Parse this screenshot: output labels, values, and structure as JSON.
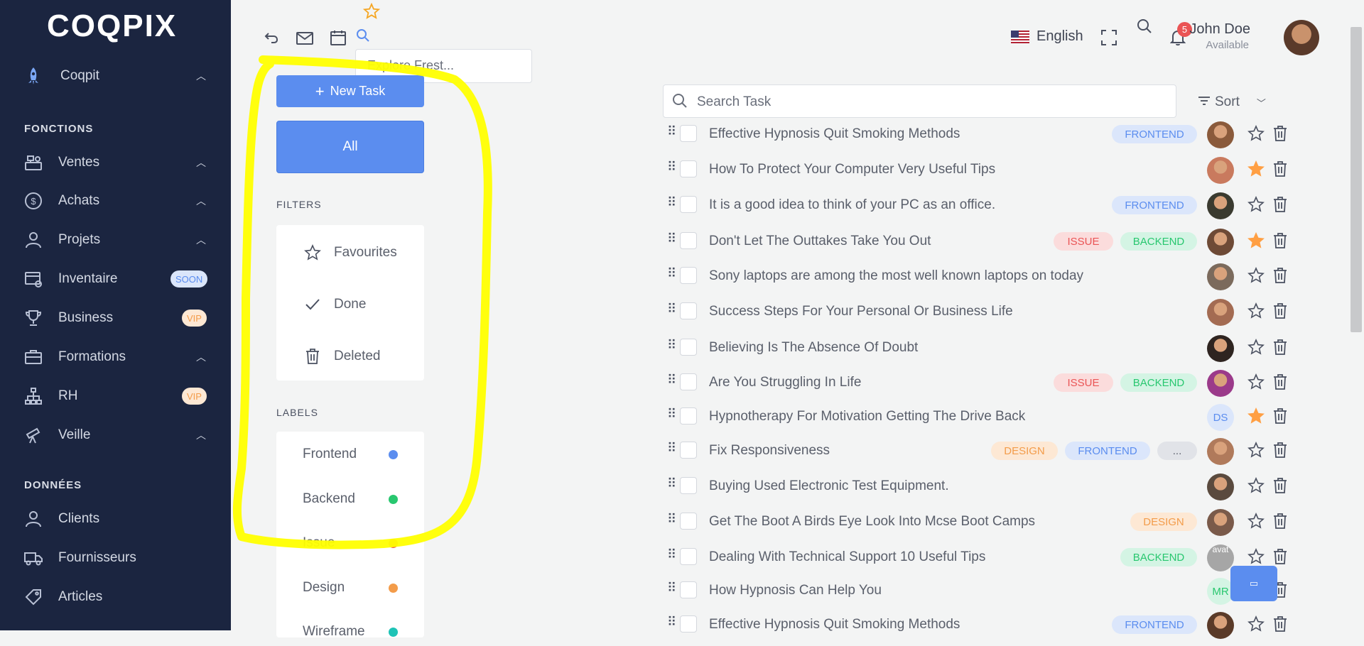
{
  "sidebar": {
    "logo": "COQPIX",
    "top_item": "Coqpit",
    "sections": [
      {
        "title": "FONCTIONS"
      },
      {
        "title": "DONNÉES"
      }
    ],
    "items": [
      {
        "label": "Ventes",
        "icon": "cash-register-icon"
      },
      {
        "label": "Achats",
        "icon": "dollar-circle-icon"
      },
      {
        "label": "Projets",
        "icon": "user-icon"
      },
      {
        "label": "Inventaire",
        "icon": "inventory-icon",
        "badge": "SOON"
      },
      {
        "label": "Business",
        "icon": "trophy-icon",
        "badge": "VIP"
      },
      {
        "label": "Formations",
        "icon": "briefcase-icon"
      },
      {
        "label": "RH",
        "icon": "org-chart-icon",
        "badge": "VIP"
      },
      {
        "label": "Veille",
        "icon": "telescope-icon"
      },
      {
        "label": "Clients",
        "icon": "user-icon"
      },
      {
        "label": "Fournisseurs",
        "icon": "truck-icon"
      },
      {
        "label": "Articles",
        "icon": "tag-icon"
      }
    ]
  },
  "topbar": {
    "explore_placeholder": "Explore Frest...",
    "language": "English",
    "notification_count": "5",
    "user_name": "John Doe",
    "user_status": "Available"
  },
  "panel": {
    "new_task": "New Task",
    "all": "All",
    "filters_title": "FILTERS",
    "filters": [
      "Favourites",
      "Done",
      "Deleted"
    ],
    "labels_title": "LABELS",
    "labels": [
      {
        "name": "Frontend",
        "color": "#5b8def"
      },
      {
        "name": "Backend",
        "color": "#28c76f"
      },
      {
        "name": "Issue",
        "color": "#ea5455"
      },
      {
        "name": "Design",
        "color": "#f39c4a"
      },
      {
        "name": "Wireframe",
        "color": "#1ec3b6"
      }
    ]
  },
  "main": {
    "search_placeholder": "Search Task",
    "sort_label": "Sort",
    "tasks": [
      {
        "title": "Effective Hypnosis Quit Smoking Methods",
        "tags": [
          "FRONTEND"
        ],
        "starred": false
      },
      {
        "title": "How To Protect Your Computer Very Useful Tips",
        "tags": [],
        "starred": true
      },
      {
        "title": "It is a good idea to think of your PC as an office.",
        "tags": [
          "FRONTEND"
        ],
        "starred": false
      },
      {
        "title": "Don't Let The Outtakes Take You Out",
        "tags": [
          "ISSUE",
          "BACKEND"
        ],
        "starred": true
      },
      {
        "title": "Sony laptops are among the most well known laptops on today",
        "tags": [],
        "starred": false
      },
      {
        "title": "Success Steps For Your Personal Or Business Life",
        "tags": [],
        "starred": false
      },
      {
        "title": "Believing Is The Absence Of Doubt",
        "tags": [],
        "starred": false
      },
      {
        "title": "Are You Struggling In Life",
        "tags": [
          "ISSUE",
          "BACKEND"
        ],
        "starred": false
      },
      {
        "title": "Hypnotherapy For Motivation Getting The Drive Back",
        "tags": [],
        "starred": true,
        "initials": "DS"
      },
      {
        "title": "Fix Responsiveness",
        "tags": [
          "DESIGN",
          "FRONTEND",
          "..."
        ],
        "starred": false
      },
      {
        "title": "Buying Used Electronic Test Equipment.",
        "tags": [],
        "starred": false
      },
      {
        "title": "Get The Boot A Birds Eye Look Into Mcse Boot Camps",
        "tags": [
          "DESIGN"
        ],
        "starred": false
      },
      {
        "title": "Dealing With Technical Support 10 Useful Tips",
        "tags": [
          "BACKEND"
        ],
        "starred": false,
        "broken_avatar": "avat"
      },
      {
        "title": "How Hypnosis Can Help You",
        "tags": [],
        "starred": false,
        "initials": "MR"
      },
      {
        "title": "Effective Hypnosis Quit Smoking Methods",
        "tags": [
          "FRONTEND"
        ],
        "starred": false
      }
    ]
  },
  "colors": {
    "sidebar_bg": "#1b2540",
    "accent": "#5b8def",
    "star_active": "#ff9f43",
    "highlight": "#ffff00"
  }
}
